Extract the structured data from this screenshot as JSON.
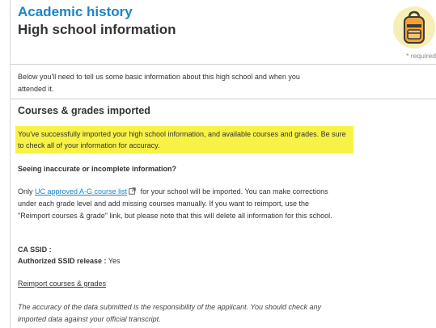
{
  "header": {
    "section_label": "Academic history",
    "title": "High school information",
    "required_note": "* required",
    "badge_icon": "backpack-icon"
  },
  "intro": {
    "text": "Below you'll need to tell us some basic information about this high school and when you attended it."
  },
  "courses": {
    "title": "Courses & grades imported",
    "success_message": "You've successfully imported your high school information, and available courses and grades. Be sure to check all of your information for accuracy.",
    "highlight_color": "#f8f246",
    "question": "Seeing inaccurate or incomplete information?",
    "para_prefix": "Only ",
    "para_link": "UC approved A-G course list",
    "para_suffix": " for your school will be imported. You can make corrections under each grade level and add missing courses manually. If you want to reimport, use the \"Reimport courses & grade\" link, but please note that this will delete all information for this school.",
    "ssid_label": "CA SSID :",
    "release_label": "Authorized SSID release :",
    "release_value": " Yes",
    "reimport_link": "Reimport courses & grades",
    "disclaimer": "The accuracy of the data submitted is the responsibility of the applicant. You should check any imported data against your official transcript."
  },
  "colors": {
    "accent": "#1a85c5",
    "badge_bg": "#f6eeb5",
    "backpack": "#f0a23a"
  }
}
